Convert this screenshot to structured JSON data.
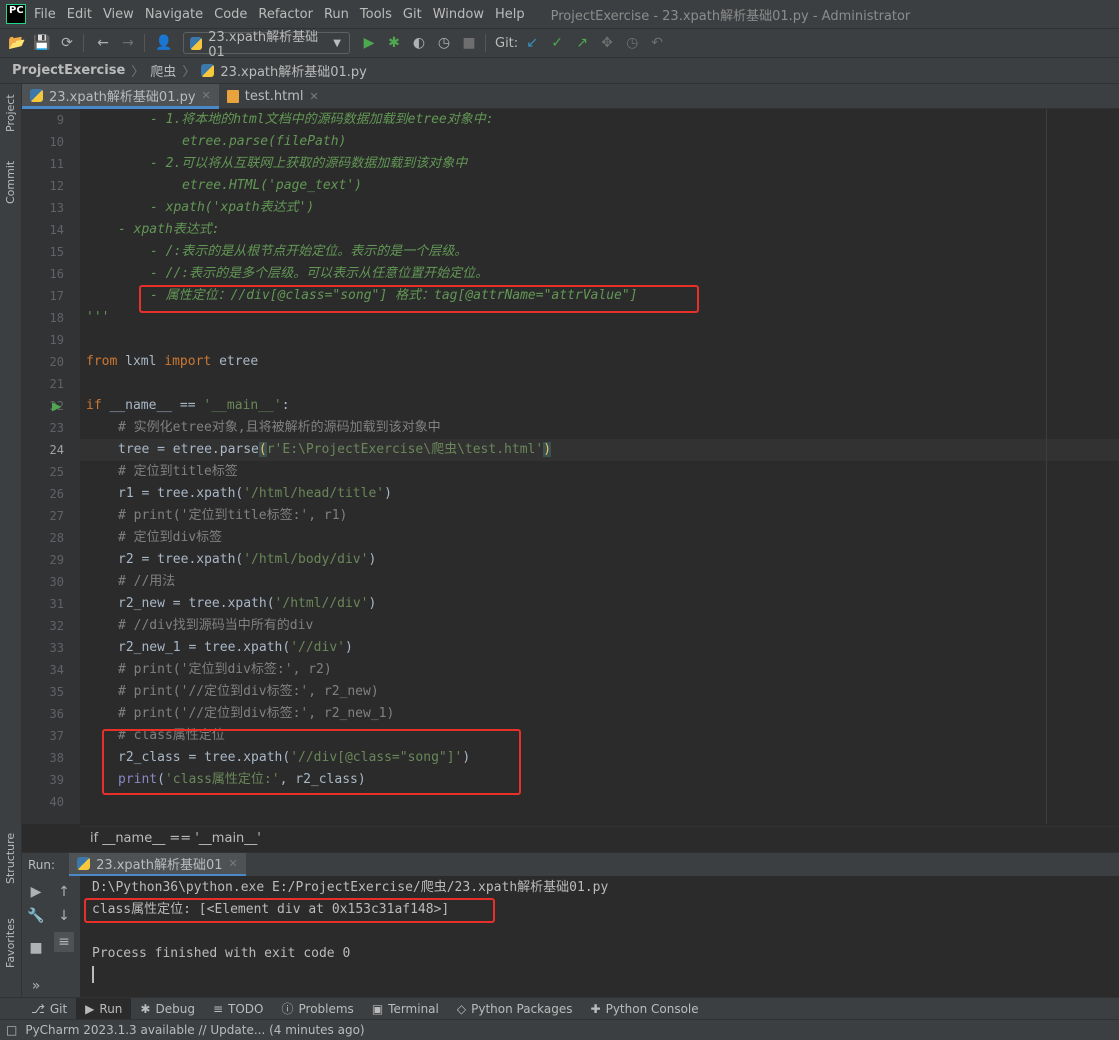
{
  "menubar": {
    "logo": "PC",
    "items": [
      "File",
      "Edit",
      "View",
      "Navigate",
      "Code",
      "Refactor",
      "Run",
      "Tools",
      "Git",
      "Window",
      "Help"
    ],
    "window_title": "ProjectExercise - 23.xpath解析基础01.py - Administrator"
  },
  "toolbar": {
    "run_config": "23.xpath解析基础01",
    "git_label": "Git:"
  },
  "breadcrumb": [
    "ProjectExercise",
    "爬虫",
    "23.xpath解析基础01.py"
  ],
  "left_strip": {
    "project": "Project",
    "commit": "Commit",
    "structure": "Structure",
    "favorites": "Favorites"
  },
  "tabs": [
    {
      "label": "23.xpath解析基础01.py",
      "icon": "python-file-icon",
      "active": true
    },
    {
      "label": "test.html",
      "icon": "html-file-icon",
      "active": false
    }
  ],
  "editor": {
    "current_line": 24,
    "line_numbers": [
      "9",
      "10",
      "11",
      "12",
      "13",
      "14",
      "15",
      "16",
      "17",
      "18",
      "19",
      "20",
      "21",
      "22",
      "23",
      "24",
      "25",
      "26",
      "27",
      "28",
      "29",
      "30",
      "31",
      "32",
      "33",
      "34",
      "35",
      "36",
      "37",
      "38",
      "39",
      "40"
    ],
    "code": {
      "l9": "- 1.将本地的html文档中的源码数据加载到etree对象中:",
      "l10": "etree.parse(filePath)",
      "l11": "- 2.可以将从互联网上获取的源码数据加载到该对象中",
      "l12": "etree.HTML('page_text')",
      "l13": "- xpath('xpath表达式')",
      "l14": "- xpath表达式:",
      "l15": "- /:表示的是从根节点开始定位。表示的是一个层级。",
      "l16": "- //:表示的是多个层级。可以表示从任意位置开始定位。",
      "l17": "- 属性定位：//div[@class=\"song\"] 格式：tag[@attrName=\"attrValue\"]",
      "l18": "'''",
      "l20_kw1": "from",
      "l20_mod": " lxml ",
      "l20_kw2": "import",
      "l20_name": " etree",
      "l22_kw": "if",
      "l22_rest": " __name__ == ",
      "l22_str": "'__main__'",
      "l22_colon": ":",
      "l23": "# 实例化etree对象,且将被解析的源码加载到该对象中",
      "l24_pre": "tree = etree.parse",
      "l24_open": "(",
      "l24_str": "r'E:\\ProjectExercise\\爬虫\\test.html'",
      "l24_close": ")",
      "l25": "# 定位到title标签",
      "l26_pre": "r1 = tree.xpath(",
      "l26_str": "'/html/head/title'",
      "l26_post": ")",
      "l27": "# print('定位到title标签:', r1)",
      "l28": "# 定位到div标签",
      "l29_pre": "r2 = tree.xpath(",
      "l29_str": "'/html/body/div'",
      "l29_post": ")",
      "l30": "# //用法",
      "l31_pre": "r2_new = tree.xpath(",
      "l31_str": "'/html//div'",
      "l31_post": ")",
      "l32": "# //div找到源码当中所有的div",
      "l33_pre": "r2_new_1 = tree.xpath(",
      "l33_str": "'//div'",
      "l33_post": ")",
      "l34": "# print('定位到div标签:', r2)",
      "l35": "# print('//定位到div标签:', r2_new)",
      "l36": "# print('//定位到div标签:', r2_new_1)",
      "l37": "# class属性定位",
      "l38_pre": "r2_class = tree.xpath(",
      "l38_str": "'//div[@class=\"song\"]'",
      "l38_post": ")",
      "l39_fn": "print",
      "l39_open": "(",
      "l39_str": "'class属性定位:'",
      "l39_post": ", r2_class)"
    },
    "bottom_breadcrumb": "if __name__ == '__main__'"
  },
  "run_panel": {
    "label": "Run:",
    "tab": "23.xpath解析基础01",
    "output": [
      "D:\\Python36\\python.exe E:/ProjectExercise/爬虫/23.xpath解析基础01.py",
      "class属性定位: [<Element div at 0x153c31af148>]",
      "",
      "Process finished with exit code 0"
    ]
  },
  "toolwindows": [
    {
      "label": "Git",
      "icon": "git-branch-icon"
    },
    {
      "label": "Run",
      "icon": "run-icon",
      "active": true
    },
    {
      "label": "Debug",
      "icon": "bug-icon"
    },
    {
      "label": "TODO",
      "icon": "todo-icon"
    },
    {
      "label": "Problems",
      "icon": "problems-icon"
    },
    {
      "label": "Terminal",
      "icon": "terminal-icon"
    },
    {
      "label": "Python Packages",
      "icon": "packages-icon"
    },
    {
      "label": "Python Console",
      "icon": "python-console-icon"
    }
  ],
  "statusbar": {
    "message": "PyCharm 2023.1.3 available // Update... (4 minutes ago)"
  },
  "colors": {
    "highlight_box": "#e8302a",
    "accent": "#4a88c7"
  }
}
